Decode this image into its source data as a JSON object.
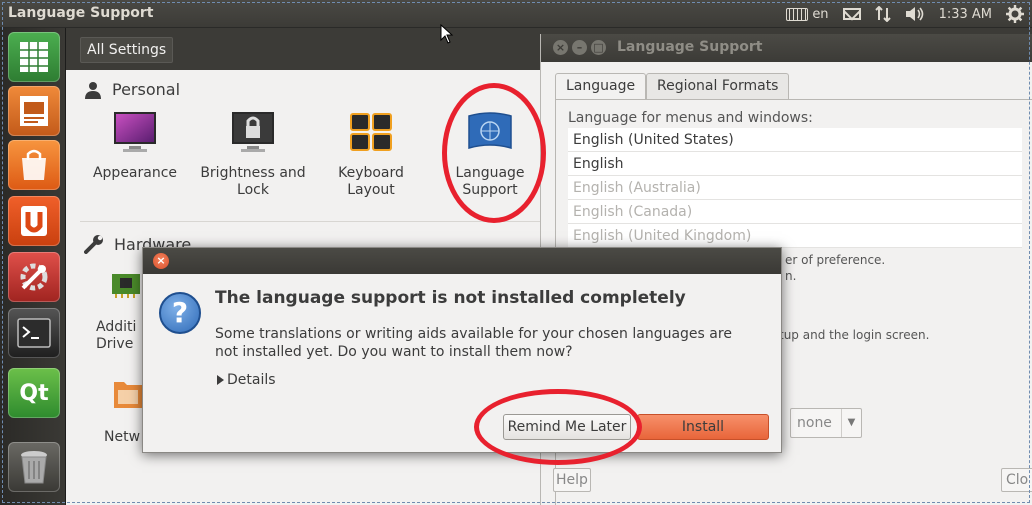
{
  "top_panel": {
    "title": "Language Support",
    "keyboard_layout": "en",
    "clock": "1:33 AM",
    "icons": [
      "keyboard-icon",
      "mail-icon",
      "network-icon",
      "volume-icon",
      "gear-icon"
    ]
  },
  "launcher": {
    "items": [
      {
        "name": "spreadsheet-icon",
        "color": "#2e7d32"
      },
      {
        "name": "presentation-icon",
        "color": "#c25a1a"
      },
      {
        "name": "shopping-bag-icon",
        "color": "#e56a1d"
      },
      {
        "name": "ubuntu-one-icon",
        "color": "#dd4814"
      },
      {
        "name": "system-settings-icon",
        "color": "#c9302c"
      },
      {
        "name": "terminal-icon",
        "color": "#2a2a2a"
      },
      {
        "name": "qt-icon",
        "color": "#41a03a"
      },
      {
        "name": "trash-icon",
        "color": "#5a5955"
      }
    ]
  },
  "settings": {
    "all_settings_label": "All Settings",
    "personal_label": "Personal",
    "hardware_label": "Hardware",
    "personal_items": [
      {
        "label": "Appearance"
      },
      {
        "label": "Brightness and Lock"
      },
      {
        "label": "Keyboard Layout"
      },
      {
        "label": "Language Support"
      }
    ],
    "hardware_items": [
      {
        "label": "Additi Drive"
      },
      {
        "label": "Netw"
      }
    ]
  },
  "lang_window": {
    "title": "Language Support",
    "tabs": [
      "Language",
      "Regional Formats"
    ],
    "list_label": "Language for menus and windows:",
    "languages": [
      {
        "label": "English (United States)",
        "dim": false
      },
      {
        "label": "English",
        "dim": false
      },
      {
        "label": "English (Australia)",
        "dim": true
      },
      {
        "label": "English (Canada)",
        "dim": true
      },
      {
        "label": "English (United Kingdom)",
        "dim": true
      }
    ],
    "fragment_preference": "er of preference.",
    "fragment_n": "n.",
    "fragment_login": "tup and the login screen.",
    "combo_value": "none",
    "help_label": "Help",
    "close_label": "Clo"
  },
  "dialog": {
    "heading": "The language support is not installed completely",
    "body": "Some translations or writing aids available for your chosen languages are not installed yet. Do you want to install them now?",
    "details_label": "Details",
    "remind_label": "Remind Me Later",
    "install_label": "Install"
  },
  "colors": {
    "annotation_red": "#e8212e",
    "install_orange": "#e8653a",
    "panel_dark": "#3c3b37"
  }
}
